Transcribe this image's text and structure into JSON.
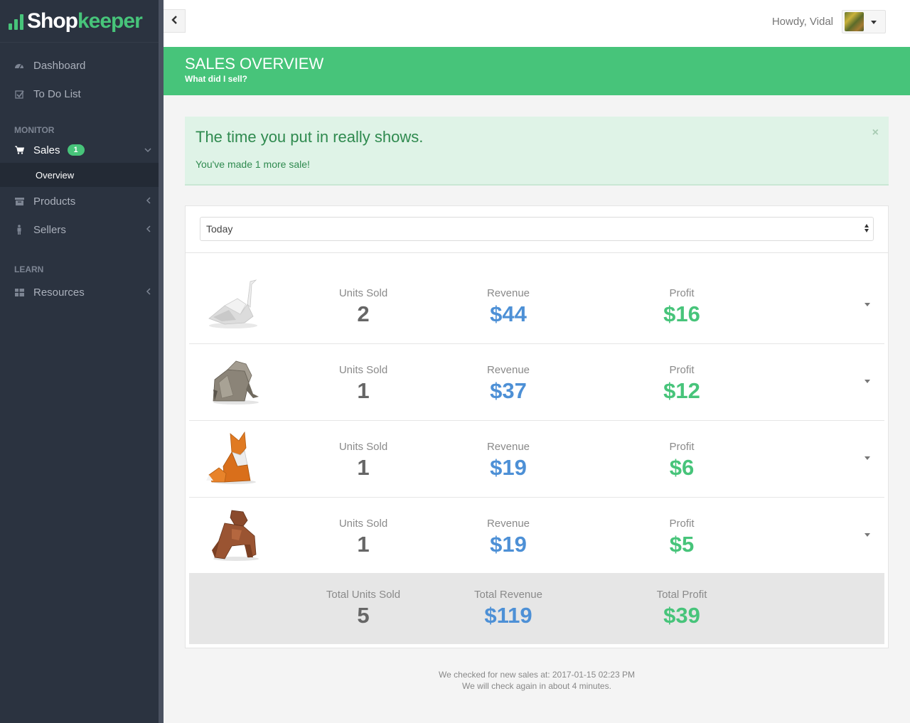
{
  "brand": {
    "part1": "Shop",
    "part2": "keeper"
  },
  "sidebar": {
    "items_top": [
      {
        "label": "Dashboard",
        "icon": "dashboard-icon"
      },
      {
        "label": "To Do List",
        "icon": "checkbox-icon"
      }
    ],
    "section_monitor": "MONITOR",
    "sales": {
      "label": "Sales",
      "badge": "1",
      "sub_label": "Overview"
    },
    "items_monitor": [
      {
        "label": "Products",
        "icon": "archive-icon"
      },
      {
        "label": "Sellers",
        "icon": "person-icon"
      }
    ],
    "section_learn": "LEARN",
    "items_learn": [
      {
        "label": "Resources",
        "icon": "grid-icon"
      }
    ]
  },
  "header": {
    "greeting": "Howdy, Vidal"
  },
  "page": {
    "title": "SALES OVERVIEW",
    "subtitle": "What did I sell?"
  },
  "alert": {
    "title": "The time you put in really shows.",
    "text": "You've made 1 more sale!",
    "close": "×"
  },
  "filter": {
    "selected": "Today"
  },
  "labels": {
    "units": "Units Sold",
    "revenue": "Revenue",
    "profit": "Profit",
    "total_units": "Total Units Sold",
    "total_revenue": "Total Revenue",
    "total_profit": "Total Profit"
  },
  "rows": [
    {
      "product": "origami-swan",
      "units": "2",
      "revenue": "$44",
      "profit": "$16"
    },
    {
      "product": "origami-elephant",
      "units": "1",
      "revenue": "$37",
      "profit": "$12"
    },
    {
      "product": "origami-fox",
      "units": "1",
      "revenue": "$19",
      "profit": "$6"
    },
    {
      "product": "origami-gorilla",
      "units": "1",
      "revenue": "$19",
      "profit": "$5"
    }
  ],
  "totals": {
    "units": "5",
    "revenue": "$119",
    "profit": "$39"
  },
  "footer": {
    "checked": "We checked for new sales at: 2017-01-15 02:23 PM",
    "next": "We will check again in about 4 minutes."
  },
  "colors": {
    "accent_green": "#47c47a",
    "revenue_blue": "#4d90d6",
    "sidebar_bg": "#2b3340"
  }
}
